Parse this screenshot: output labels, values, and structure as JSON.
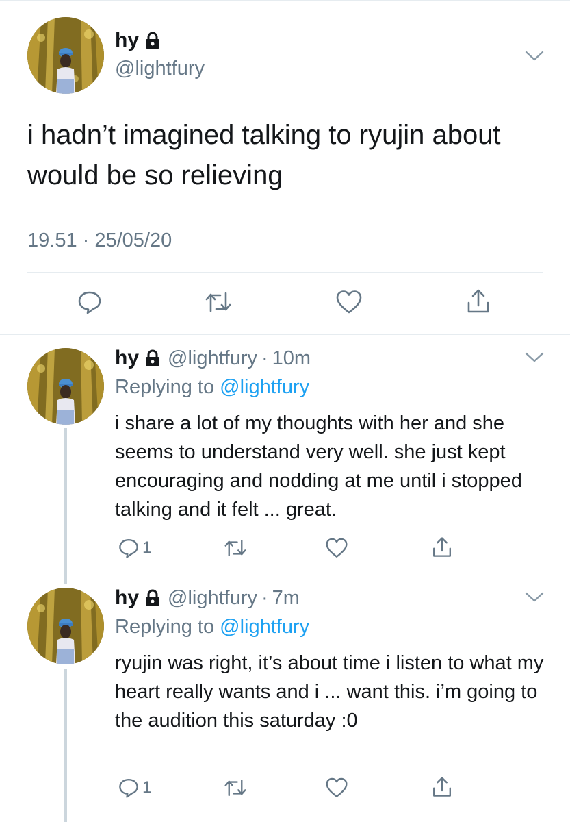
{
  "main_tweet": {
    "display_name": "hy",
    "handle": "@lightfury",
    "text": "i hadn’t imagined talking to ryujin about would be so relieving",
    "timestamp": "19.51 · 25/05/20"
  },
  "replies": [
    {
      "display_name": "hy",
      "handle": "@lightfury",
      "separator": "·",
      "time": "10m",
      "replying_prefix": "Replying to ",
      "replying_to": "@lightfury",
      "text": "i share a lot of my thoughts with her and she seems to understand very well. she just kept encouraging and nodding at me until i stopped talking and it felt ... great.",
      "reply_count": "1"
    },
    {
      "display_name": "hy",
      "handle": "@lightfury",
      "separator": "·",
      "time": "7m",
      "replying_prefix": "Replying to ",
      "replying_to": "@lightfury",
      "text": "ryujin was right, it’s about time i listen to what my heart really wants and i ... want this. i’m going to the audition this saturday :0",
      "reply_count": "1"
    }
  ],
  "icons": {
    "lock": "lock-icon",
    "chevron": "chevron-down-icon",
    "reply": "reply-icon",
    "retweet": "retweet-icon",
    "like": "heart-icon",
    "share": "share-icon"
  },
  "colors": {
    "text": "#14171a",
    "secondary": "#657786",
    "link": "#1da1f2",
    "divider": "#e6ecf0",
    "thread_line": "#ccd6dd"
  }
}
